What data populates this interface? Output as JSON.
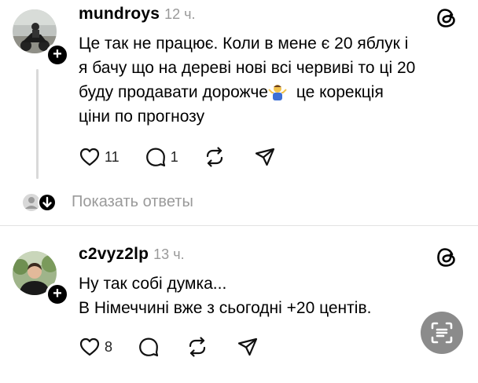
{
  "comments": [
    {
      "username": "mundroys",
      "time": "12 ч.",
      "lines": [
        "Це так не працює. Коли в мене є 20 яблук і",
        "я бачу що на дереві нові всі червиві то ці 20",
        "буду продавати дорожче",
        "це корекція",
        "ціни по прогнозу"
      ],
      "emoji": "person-shrugging-emoji",
      "likes": "11",
      "replies": "1"
    },
    {
      "username": "c2vyz2lp",
      "time": "13 ч.",
      "lines": [
        "Ну так собі думка...",
        "В Німеччині вже з сьогодні +20 центів."
      ],
      "likes": "8"
    }
  ],
  "show_replies": "Показать ответы",
  "icons": [
    "threads-logo-icon",
    "heart-icon",
    "comment-icon",
    "repost-icon",
    "share-icon",
    "plus-icon",
    "chevron-down-icon",
    "scan-text-icon"
  ]
}
